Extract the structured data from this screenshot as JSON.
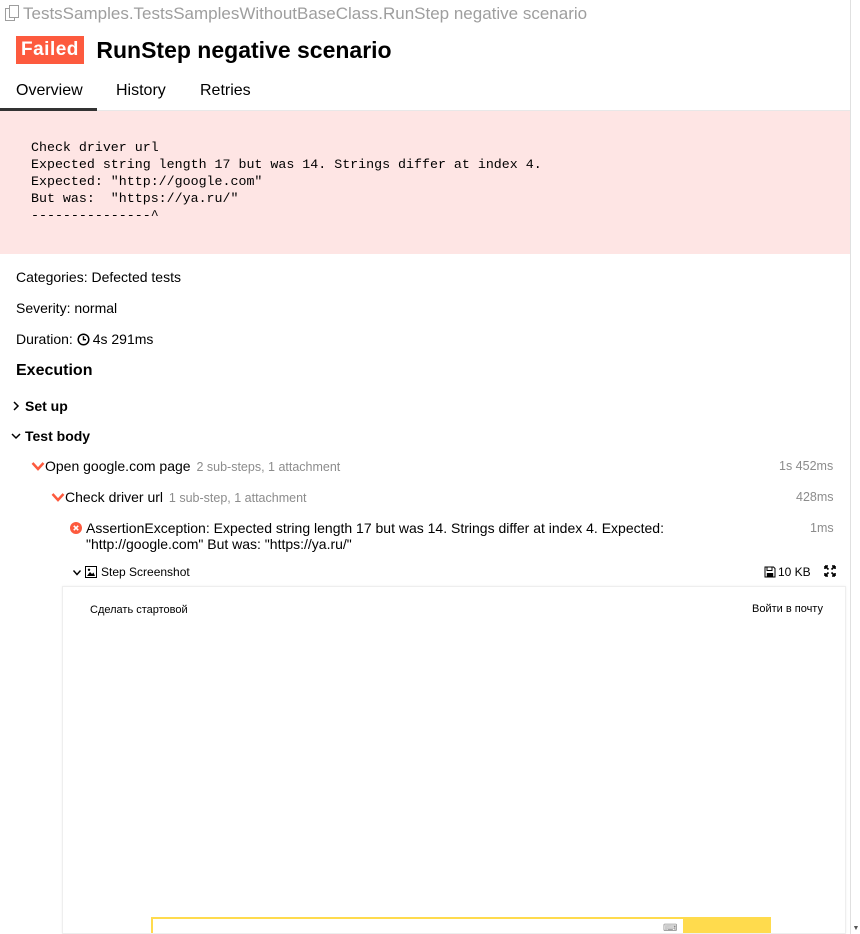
{
  "header": {
    "path": "TestsSamples.TestsSamplesWithoutBaseClass.RunStep negative scenario",
    "status_badge": "Failed",
    "title": "RunStep negative scenario"
  },
  "tabs": [
    {
      "label": "Overview",
      "active": true
    },
    {
      "label": "History",
      "active": false
    },
    {
      "label": "Retries",
      "active": false
    }
  ],
  "error": {
    "message": "Check driver url\nExpected string length 17 but was 14. Strings differ at index 4.\nExpected: \"http://google.com\"\nBut was:  \"https://ya.ru/\"\n---------------^"
  },
  "meta": {
    "categories": "Categories: Defected tests",
    "severity": "Severity: normal",
    "duration_label": "Duration:",
    "duration_value": "4s 291ms"
  },
  "execution": {
    "title": "Execution",
    "setup_label": "Set up",
    "body_label": "Test body",
    "steps": [
      {
        "name": "Open google.com page",
        "sub": "2 sub-steps, 1 attachment",
        "duration": "1s 452ms"
      },
      {
        "name": "Check driver url",
        "sub": "1 sub-step, 1 attachment",
        "duration": "428ms"
      }
    ],
    "assertion": {
      "message": "AssertionException: Expected string length 17 but was 14. Strings differ at index 4. Expected: \"http://google.com\" But was: \"https://ya.ru/\"",
      "duration": "1ms"
    },
    "attachment": {
      "label": "Step Screenshot",
      "size": "10 KB"
    }
  },
  "screenshot": {
    "left_link": "Сделать стартовой",
    "right_link": "Войти в почту"
  },
  "colors": {
    "failed": "#fd5a3e",
    "error_bg": "#fee5e4",
    "muted": "#8c8c8c",
    "search_yellow": "#ffdb4d"
  }
}
